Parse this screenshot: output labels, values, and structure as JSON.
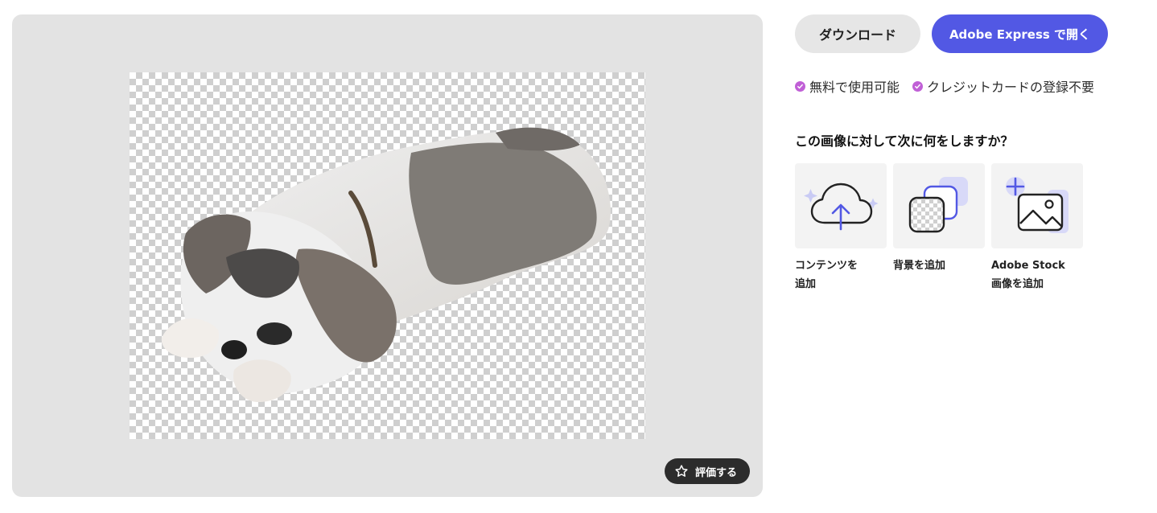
{
  "preview": {
    "rate_label": "評価する"
  },
  "actions": {
    "download_label": "ダウンロード",
    "open_label": "Adobe Express で開く"
  },
  "features": [
    "無料で使用可能",
    "クレジットカードの登録不要"
  ],
  "next_steps": {
    "question": "この画像に対して次に何をしますか？",
    "cards": [
      {
        "line1": "コンテンツを",
        "line2": "追加",
        "icon": "cloud-upload-icon"
      },
      {
        "line1": "背景を追加",
        "line2": "",
        "icon": "background-layers-icon"
      },
      {
        "line1": "Adobe Stock",
        "line2": "画像を追加",
        "icon": "add-image-icon"
      }
    ]
  },
  "colors": {
    "accent": "#5258e4",
    "check": "#c05fd6"
  }
}
